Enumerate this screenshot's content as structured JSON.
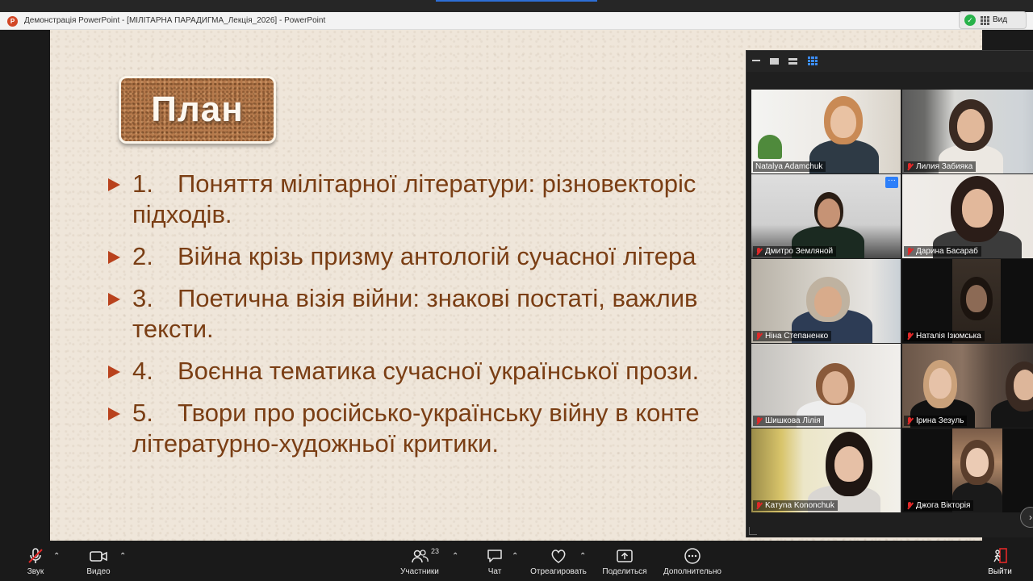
{
  "window": {
    "app_icon": "powerpoint-icon",
    "title": "Демонстрація PowerPoint - [МІЛІТАРНА ПАРАДИГМА_Лекція_2026] - PowerPoint",
    "view_button_label": "Вид"
  },
  "slide": {
    "heading": "План",
    "items": [
      {
        "num": "1.",
        "line1": "Поняття мілітарної літератури: різновекторіс",
        "line2": "підходів."
      },
      {
        "num": "2.",
        "line1": "Війна крізь призму антологій сучасної літера",
        "line2": ""
      },
      {
        "num": "3.",
        "line1": "Поетична візія війни: знакові постаті, важлив",
        "line2": "тексти."
      },
      {
        "num": "4.",
        "line1": "Воєнна тематика сучасної української прози.",
        "line2": ""
      },
      {
        "num": "5.",
        "line1": "Твори про російсько-українську війну в конте",
        "line2": "літературно-художньої критики."
      }
    ],
    "colors": {
      "text": "#7a3e14",
      "bullet": "#b9421d",
      "background": "#efe6da"
    }
  },
  "video_panel": {
    "toolbar_icons": [
      "minimize-icon",
      "speaker-view-icon",
      "split-view-icon",
      "gallery-view-icon"
    ],
    "participants": [
      {
        "name": "Natalya Adamchuk",
        "muted": false,
        "active": true
      },
      {
        "name": "Лилия Забияка",
        "muted": true,
        "active": false
      },
      {
        "name": "Дмитро Земляной",
        "muted": true,
        "active": false
      },
      {
        "name": "Дарина Басараб",
        "muted": true,
        "active": false
      },
      {
        "name": "Ніна Степаненко",
        "muted": true,
        "active": false
      },
      {
        "name": "Наталія Ізюмська",
        "muted": true,
        "active": false
      },
      {
        "name": "Шишкова Лілія",
        "muted": true,
        "active": false
      },
      {
        "name": "Ірина Зезуль",
        "muted": true,
        "active": false
      },
      {
        "name": "Kaтуna Kononchuk",
        "muted": true,
        "active": false
      },
      {
        "name": "Джога Вікторія",
        "muted": true,
        "active": false
      }
    ],
    "more_button": "···"
  },
  "toolbar": {
    "audio": "Звук",
    "video": "Видео",
    "participants": "Участники",
    "participants_count": "23",
    "chat": "Чат",
    "react": "Отреагировать",
    "share": "Поделиться",
    "more": "Дополнительно",
    "leave": "Выйти"
  }
}
